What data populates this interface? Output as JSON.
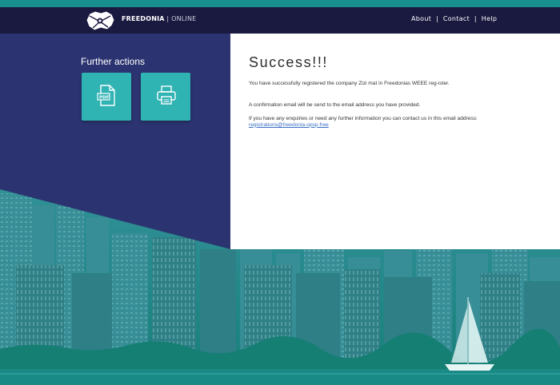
{
  "header": {
    "brand_bold": "FREEDONIA",
    "brand_sep": "|",
    "brand_rest": "ONLINE",
    "nav": [
      {
        "label": "About"
      },
      {
        "label": "Contact"
      },
      {
        "label": "Help"
      }
    ],
    "nav_sep": "|"
  },
  "sidebar": {
    "title": "Further actions",
    "actions": [
      {
        "icon": "pdf-icon"
      },
      {
        "icon": "printer-icon"
      }
    ]
  },
  "main": {
    "heading": "Success!!!",
    "paragraph1": "You have successfully registered the company Zizi mat in Freedonias WEEE reg-ister.",
    "paragraph2": "A confirmation email will be send to the email address you have provided.",
    "paragraph3_text": "If you have any enquiries or need any further information you can contact us in this email address: ",
    "contact_email": "registrations@freedonia-opsp.free"
  },
  "colors": {
    "header_bg": "#1a1940",
    "sidebar_bg": "#2b3470",
    "tile_bg": "#2fb3b3",
    "link": "#3a6fc4",
    "background_teal": "#1a8f8f"
  }
}
